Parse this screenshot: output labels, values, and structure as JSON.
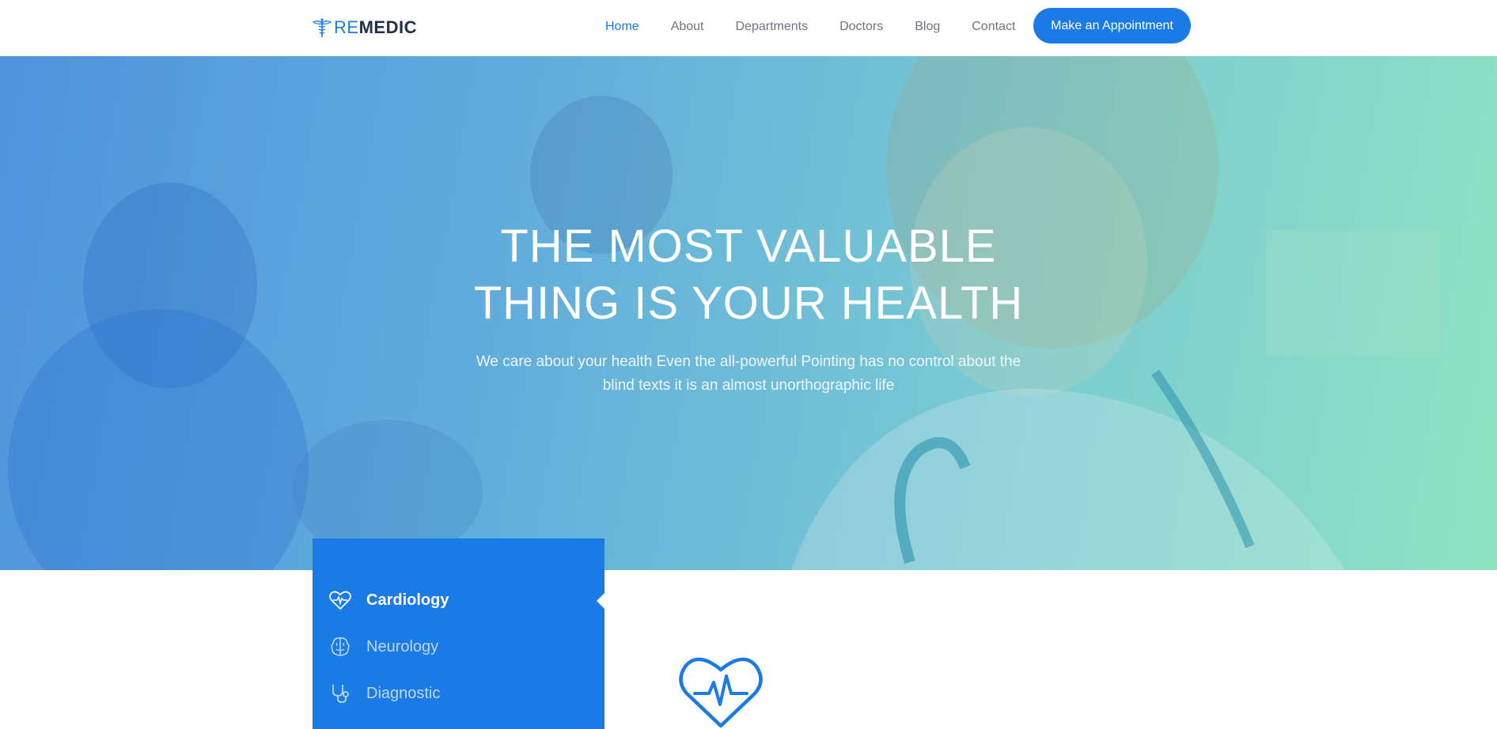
{
  "brand": {
    "prefix": "RE",
    "name": "MEDIC"
  },
  "nav": {
    "items": [
      {
        "label": "Home",
        "active": true
      },
      {
        "label": "About",
        "active": false
      },
      {
        "label": "Departments",
        "active": false
      },
      {
        "label": "Doctors",
        "active": false
      },
      {
        "label": "Blog",
        "active": false
      },
      {
        "label": "Contact",
        "active": false
      }
    ],
    "cta": "Make an Appointment"
  },
  "hero": {
    "title_line1": "THE MOST VALUABLE",
    "title_line2": "THING IS YOUR HEALTH",
    "subtitle_line1": "We care about your health Even the all-powerful Pointing has no control about the",
    "subtitle_line2": "blind texts it is an almost unorthographic life"
  },
  "departments": {
    "items": [
      {
        "label": "Cardiology",
        "icon": "heart-pulse-icon",
        "active": true
      },
      {
        "label": "Neurology",
        "icon": "brain-icon",
        "active": false
      },
      {
        "label": "Diagnostic",
        "icon": "stethoscope-icon",
        "active": false
      }
    ],
    "featured_icon": "heart-pulse-icon"
  },
  "colors": {
    "accent": "#1a7ae6",
    "dark": "#1f2e4a",
    "nav_text": "#6c7480"
  }
}
